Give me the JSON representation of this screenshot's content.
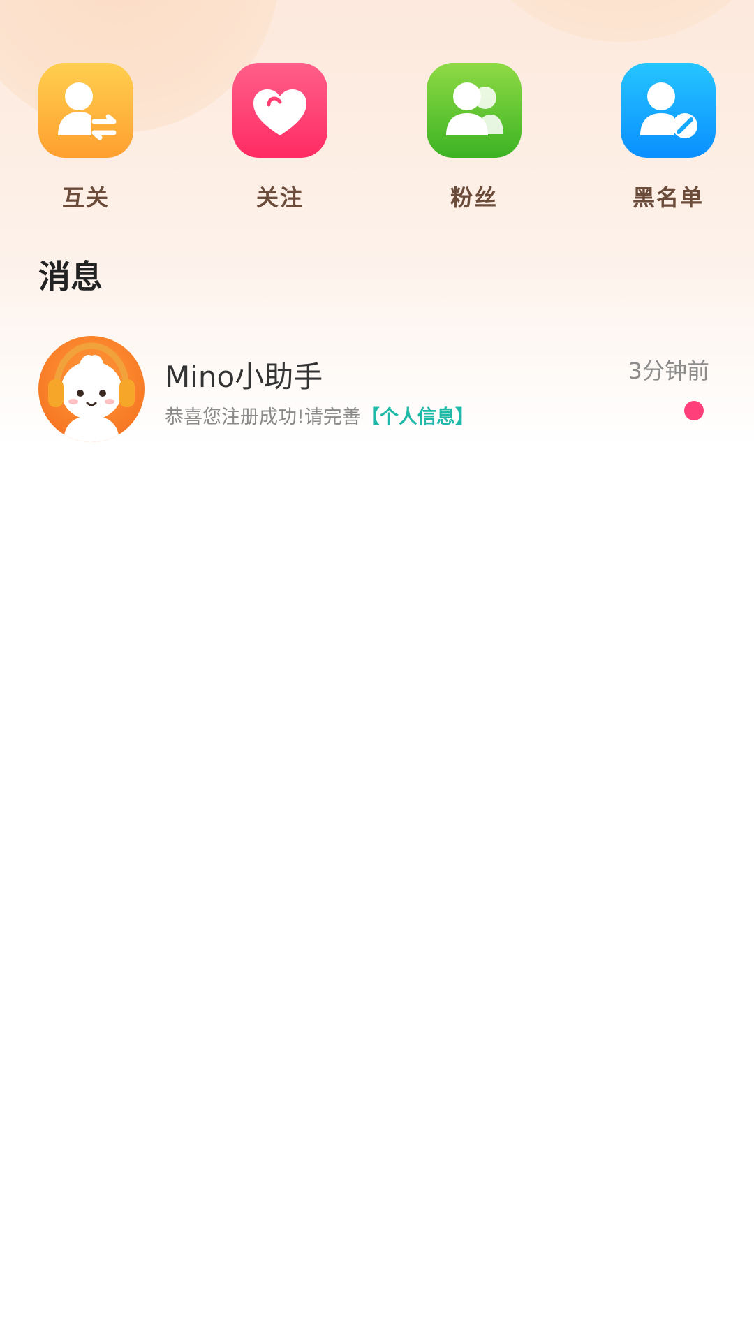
{
  "quick_actions": [
    {
      "label": "互关",
      "icon": "mutual-follow-icon",
      "color": "#ffb03f"
    },
    {
      "label": "关注",
      "icon": "hearts-icon",
      "color": "#ff3d70"
    },
    {
      "label": "粉丝",
      "icon": "fans-group-icon",
      "color": "#5cc42f"
    },
    {
      "label": "黑名单",
      "icon": "blacklist-user-icon",
      "color": "#15a8ff"
    }
  ],
  "messages_section": {
    "title": "消息"
  },
  "messages": [
    {
      "name": "Mino小助手",
      "preview_text": "恭喜您注册成功!请完善",
      "preview_link": "【个人信息】",
      "time": "3分钟前",
      "unread": true
    }
  ],
  "colors": {
    "link": "#1fb9a8",
    "unread_dot": "#ff3f7a",
    "label": "#6b4b3a"
  }
}
